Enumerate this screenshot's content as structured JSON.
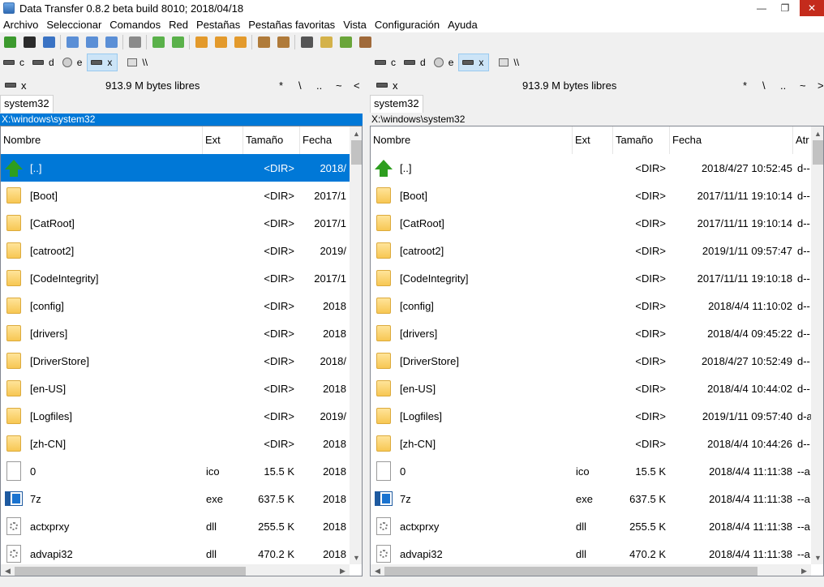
{
  "window": {
    "title": "Data Transfer 0.8.2 beta build 8010; 2018/04/18",
    "minimize": "—",
    "maximize": "❐",
    "close": "✕"
  },
  "menu": [
    "Archivo",
    "Seleccionar",
    "Comandos",
    "Red",
    "Pestañas",
    "Pestañas favoritas",
    "Vista",
    "Configuración",
    "Ayuda"
  ],
  "toolbar_icons": [
    "refresh-icon",
    "terminal-icon",
    "settings-icon",
    "view-list-icon",
    "view-details-icon",
    "view-thumbnails-icon",
    "sync-icon",
    "copy-left-icon",
    "copy-right-icon",
    "pack-icon",
    "unpack-icon",
    "split-icon",
    "archive-icon",
    "extract-icon",
    "find-icon",
    "edit-icon",
    "compare-icon",
    "copy-icon"
  ],
  "drives": [
    {
      "letter": "c",
      "type": "drive",
      "active": false
    },
    {
      "letter": "d",
      "type": "drive",
      "active": false
    },
    {
      "letter": "e",
      "type": "network",
      "active": false
    },
    {
      "letter": "x",
      "type": "drive",
      "active": true
    },
    {
      "letter": "\\\\",
      "type": "unc",
      "active": false
    }
  ],
  "left": {
    "drive": "x",
    "free": "913.9 M bytes libres",
    "nav": [
      "*",
      "\\",
      "..",
      "~",
      "<"
    ],
    "tab": "system32",
    "path": "X:\\windows\\system32",
    "columns": {
      "name": "Nombre",
      "ext": "Ext",
      "size": "Tamaño",
      "date": "Fecha"
    },
    "rows": [
      {
        "icon": "up",
        "name": "[..]",
        "ext": "",
        "size": "<DIR>",
        "date": "2018/",
        "selected": true
      },
      {
        "icon": "folder",
        "name": "[Boot]",
        "ext": "",
        "size": "<DIR>",
        "date": "2017/1",
        "selected": false
      },
      {
        "icon": "folder",
        "name": "[CatRoot]",
        "ext": "",
        "size": "<DIR>",
        "date": "2017/1",
        "selected": false
      },
      {
        "icon": "folder",
        "name": "[catroot2]",
        "ext": "",
        "size": "<DIR>",
        "date": "2019/",
        "selected": false
      },
      {
        "icon": "folder",
        "name": "[CodeIntegrity]",
        "ext": "",
        "size": "<DIR>",
        "date": "2017/1",
        "selected": false
      },
      {
        "icon": "folder",
        "name": "[config]",
        "ext": "",
        "size": "<DIR>",
        "date": "2018",
        "selected": false
      },
      {
        "icon": "folder",
        "name": "[drivers]",
        "ext": "",
        "size": "<DIR>",
        "date": "2018",
        "selected": false
      },
      {
        "icon": "folder",
        "name": "[DriverStore]",
        "ext": "",
        "size": "<DIR>",
        "date": "2018/",
        "selected": false
      },
      {
        "icon": "folder",
        "name": "[en-US]",
        "ext": "",
        "size": "<DIR>",
        "date": "2018",
        "selected": false
      },
      {
        "icon": "folder",
        "name": "[Logfiles]",
        "ext": "",
        "size": "<DIR>",
        "date": "2019/",
        "selected": false
      },
      {
        "icon": "folder",
        "name": "[zh-CN]",
        "ext": "",
        "size": "<DIR>",
        "date": "2018",
        "selected": false
      },
      {
        "icon": "file",
        "name": "0",
        "ext": "ico",
        "size": "15.5 K",
        "date": "2018",
        "selected": false
      },
      {
        "icon": "exe",
        "name": "7z",
        "ext": "exe",
        "size": "637.5 K",
        "date": "2018",
        "selected": false
      },
      {
        "icon": "dll",
        "name": "actxprxy",
        "ext": "dll",
        "size": "255.5 K",
        "date": "2018",
        "selected": false
      },
      {
        "icon": "dll",
        "name": "advapi32",
        "ext": "dll",
        "size": "470.2 K",
        "date": "2018",
        "selected": false
      }
    ]
  },
  "right": {
    "drive": "x",
    "free": "913.9 M bytes libres",
    "nav": [
      "*",
      "\\",
      "..",
      "~",
      ">"
    ],
    "tab": "system32",
    "path": "X:\\windows\\system32",
    "columns": {
      "name": "Nombre",
      "ext": "Ext",
      "size": "Tamaño",
      "date": "Fecha",
      "attr": "Atr"
    },
    "rows": [
      {
        "icon": "up",
        "name": "[..]",
        "ext": "",
        "size": "<DIR>",
        "date": "2018/4/27 10:52:45",
        "attr": "d--"
      },
      {
        "icon": "folder",
        "name": "[Boot]",
        "ext": "",
        "size": "<DIR>",
        "date": "2017/11/11 19:10:14",
        "attr": "d--"
      },
      {
        "icon": "folder",
        "name": "[CatRoot]",
        "ext": "",
        "size": "<DIR>",
        "date": "2017/11/11 19:10:14",
        "attr": "d--"
      },
      {
        "icon": "folder",
        "name": "[catroot2]",
        "ext": "",
        "size": "<DIR>",
        "date": "2019/1/11 09:57:47",
        "attr": "d--"
      },
      {
        "icon": "folder",
        "name": "[CodeIntegrity]",
        "ext": "",
        "size": "<DIR>",
        "date": "2017/11/11 19:10:18",
        "attr": "d--"
      },
      {
        "icon": "folder",
        "name": "[config]",
        "ext": "",
        "size": "<DIR>",
        "date": "2018/4/4 11:10:02",
        "attr": "d--"
      },
      {
        "icon": "folder",
        "name": "[drivers]",
        "ext": "",
        "size": "<DIR>",
        "date": "2018/4/4 09:45:22",
        "attr": "d--"
      },
      {
        "icon": "folder",
        "name": "[DriverStore]",
        "ext": "",
        "size": "<DIR>",
        "date": "2018/4/27 10:52:49",
        "attr": "d--"
      },
      {
        "icon": "folder",
        "name": "[en-US]",
        "ext": "",
        "size": "<DIR>",
        "date": "2018/4/4 10:44:02",
        "attr": "d--"
      },
      {
        "icon": "folder",
        "name": "[Logfiles]",
        "ext": "",
        "size": "<DIR>",
        "date": "2019/1/11 09:57:40",
        "attr": "d-a"
      },
      {
        "icon": "folder",
        "name": "[zh-CN]",
        "ext": "",
        "size": "<DIR>",
        "date": "2018/4/4 10:44:26",
        "attr": "d--"
      },
      {
        "icon": "file",
        "name": "0",
        "ext": "ico",
        "size": "15.5 K",
        "date": "2018/4/4 11:11:38",
        "attr": "--a"
      },
      {
        "icon": "exe",
        "name": "7z",
        "ext": "exe",
        "size": "637.5 K",
        "date": "2018/4/4 11:11:38",
        "attr": "--a"
      },
      {
        "icon": "dll",
        "name": "actxprxy",
        "ext": "dll",
        "size": "255.5 K",
        "date": "2018/4/4 11:11:38",
        "attr": "--a"
      },
      {
        "icon": "dll",
        "name": "advapi32",
        "ext": "dll",
        "size": "470.2 K",
        "date": "2018/4/4 11:11:38",
        "attr": "--a"
      }
    ]
  },
  "colors": {
    "selection": "#0078d7",
    "folder": "#f7c753",
    "up_arrow": "#2e9e1f",
    "close_button": "#c42b1c"
  }
}
